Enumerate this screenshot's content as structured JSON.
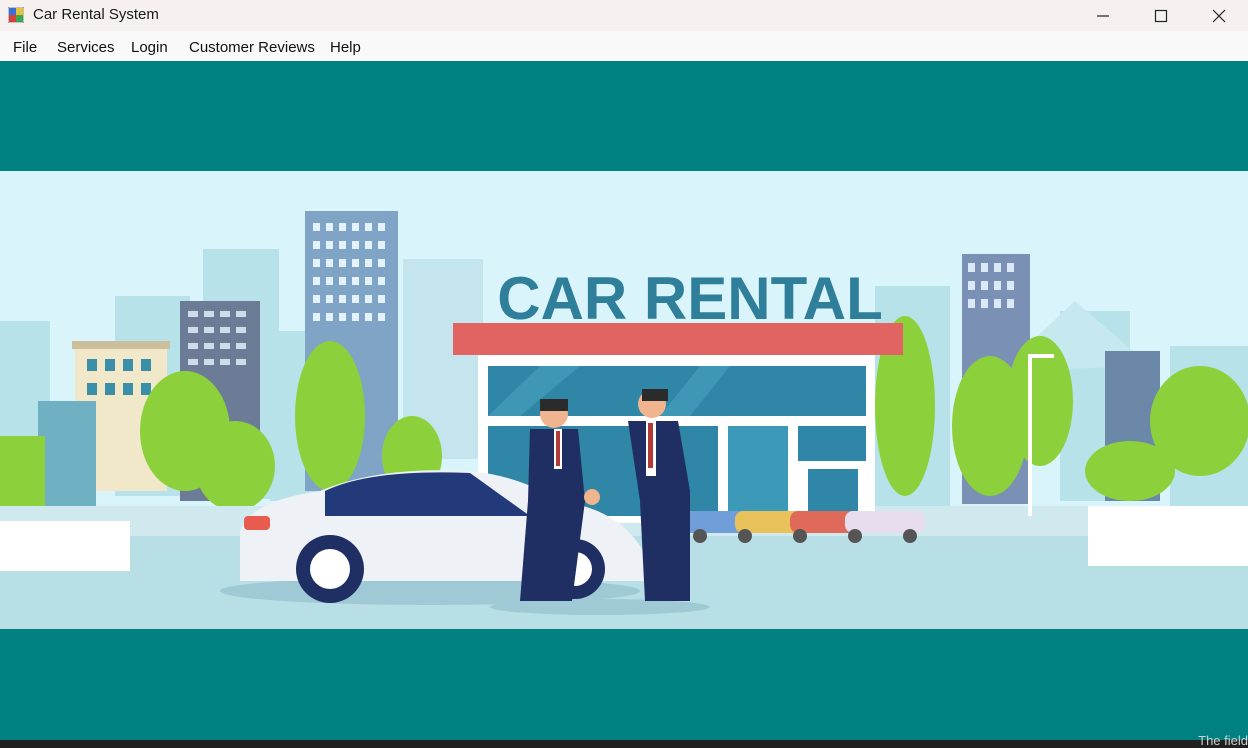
{
  "window": {
    "title": "Car Rental System",
    "icons": {
      "app": "app-icon",
      "minimize": "minimize-icon",
      "maximize": "maximize-icon",
      "close": "close-icon"
    }
  },
  "menu": {
    "items": [
      {
        "label": "File"
      },
      {
        "label": "Services"
      },
      {
        "label": "Login"
      },
      {
        "label": "Customer Reviews"
      },
      {
        "label": "Help"
      }
    ]
  },
  "banner": {
    "sign_text": "CAR RENTAL"
  },
  "colors": {
    "background": "#008080",
    "sign_text": "#2f7e9a",
    "roof": "#e16462",
    "suit": "#1f2f63"
  },
  "taskbar_fragment": "The field"
}
